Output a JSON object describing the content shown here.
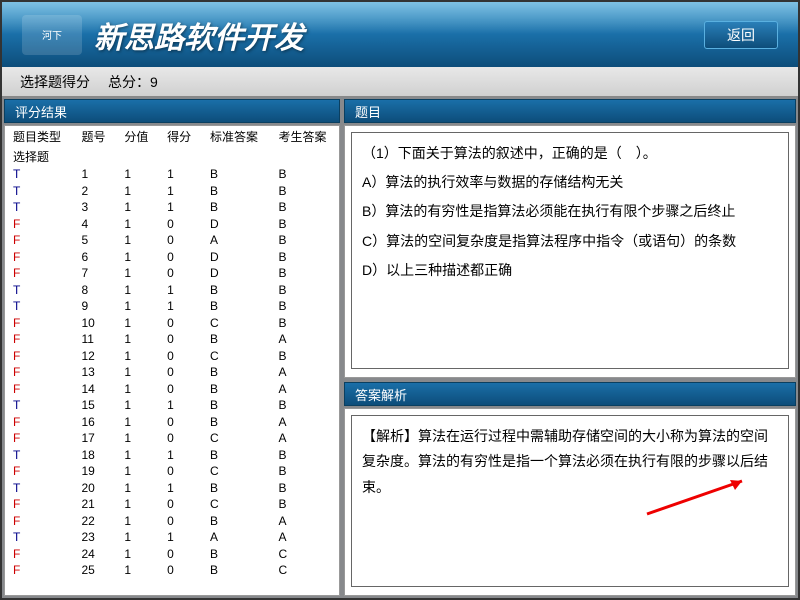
{
  "header": {
    "logo_text": "河下",
    "title": "新思路软件开发",
    "back_button": "返回"
  },
  "score_bar": {
    "label_section": "选择题得分",
    "label_total": "总分：",
    "total_value": "9"
  },
  "left_panel": {
    "title": "评分结果",
    "columns": [
      "题目类型",
      "题号",
      "分值",
      "得分",
      "标准答案",
      "考生答案"
    ],
    "type_row_label": "选择题",
    "rows": [
      {
        "idx": 1,
        "score": 1,
        "got": 1,
        "std": "B",
        "ans": "B",
        "ok": true
      },
      {
        "idx": 2,
        "score": 1,
        "got": 1,
        "std": "B",
        "ans": "B",
        "ok": true
      },
      {
        "idx": 3,
        "score": 1,
        "got": 1,
        "std": "B",
        "ans": "B",
        "ok": true
      },
      {
        "idx": 4,
        "score": 1,
        "got": 0,
        "std": "D",
        "ans": "B",
        "ok": false
      },
      {
        "idx": 5,
        "score": 1,
        "got": 0,
        "std": "A",
        "ans": "B",
        "ok": false
      },
      {
        "idx": 6,
        "score": 1,
        "got": 0,
        "std": "D",
        "ans": "B",
        "ok": false
      },
      {
        "idx": 7,
        "score": 1,
        "got": 0,
        "std": "D",
        "ans": "B",
        "ok": false
      },
      {
        "idx": 8,
        "score": 1,
        "got": 1,
        "std": "B",
        "ans": "B",
        "ok": true
      },
      {
        "idx": 9,
        "score": 1,
        "got": 1,
        "std": "B",
        "ans": "B",
        "ok": true
      },
      {
        "idx": 10,
        "score": 1,
        "got": 0,
        "std": "C",
        "ans": "B",
        "ok": false
      },
      {
        "idx": 11,
        "score": 1,
        "got": 0,
        "std": "B",
        "ans": "A",
        "ok": false
      },
      {
        "idx": 12,
        "score": 1,
        "got": 0,
        "std": "C",
        "ans": "B",
        "ok": false
      },
      {
        "idx": 13,
        "score": 1,
        "got": 0,
        "std": "B",
        "ans": "A",
        "ok": false
      },
      {
        "idx": 14,
        "score": 1,
        "got": 0,
        "std": "B",
        "ans": "A",
        "ok": false
      },
      {
        "idx": 15,
        "score": 1,
        "got": 1,
        "std": "B",
        "ans": "B",
        "ok": true
      },
      {
        "idx": 16,
        "score": 1,
        "got": 0,
        "std": "B",
        "ans": "A",
        "ok": false
      },
      {
        "idx": 17,
        "score": 1,
        "got": 0,
        "std": "C",
        "ans": "A",
        "ok": false
      },
      {
        "idx": 18,
        "score": 1,
        "got": 1,
        "std": "B",
        "ans": "B",
        "ok": true
      },
      {
        "idx": 19,
        "score": 1,
        "got": 0,
        "std": "C",
        "ans": "B",
        "ok": false
      },
      {
        "idx": 20,
        "score": 1,
        "got": 1,
        "std": "B",
        "ans": "B",
        "ok": true
      },
      {
        "idx": 21,
        "score": 1,
        "got": 0,
        "std": "C",
        "ans": "B",
        "ok": false
      },
      {
        "idx": 22,
        "score": 1,
        "got": 0,
        "std": "B",
        "ans": "A",
        "ok": false
      },
      {
        "idx": 23,
        "score": 1,
        "got": 1,
        "std": "A",
        "ans": "A",
        "ok": true
      },
      {
        "idx": 24,
        "score": 1,
        "got": 0,
        "std": "B",
        "ans": "C",
        "ok": false
      },
      {
        "idx": 25,
        "score": 1,
        "got": 0,
        "std": "B",
        "ans": "C",
        "ok": false
      }
    ]
  },
  "question_panel": {
    "title": "题目",
    "stem": "（1）下面关于算法的叙述中，正确的是（　）。",
    "options": [
      "A）算法的执行效率与数据的存储结构无关",
      "B）算法的有穷性是指算法必须能在执行有限个步骤之后终止",
      "C）算法的空间复杂度是指算法程序中指令（或语句）的条数",
      "D）以上三种描述都正确"
    ]
  },
  "answer_panel": {
    "title": "答案解析",
    "label": "【解析】",
    "text": "算法在运行过程中需辅助存储空间的大小称为算法的空间复杂度。算法的有穷性是指一个算法必须在执行有限的步骤以后结束。"
  }
}
